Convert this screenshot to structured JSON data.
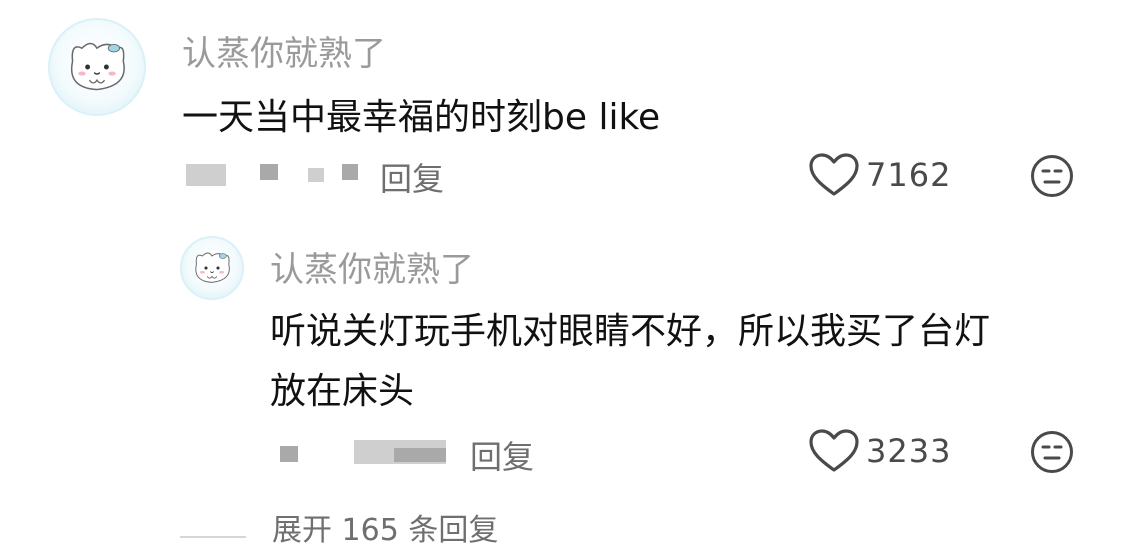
{
  "comment": {
    "username": "认蒸你就熟了",
    "text": "一天当中最幸福的时刻be like",
    "reply_label": "回复",
    "likes": "7162",
    "avatar_icon": "cat-avatar-icon",
    "like_icon": "heart-outline-icon",
    "dislike_icon": "meh-face-icon"
  },
  "reply": {
    "username": "认蒸你就熟了",
    "text_line1": "听说关灯玩手机对眼睛不好，所以我买了台灯",
    "text_line2": "放在床头",
    "reply_label": "回复",
    "likes": "3233",
    "avatar_icon": "cat-avatar-icon",
    "like_icon": "heart-outline-icon",
    "dislike_icon": "meh-face-icon"
  },
  "expand": {
    "label": "展开 165 条回复"
  },
  "colors": {
    "username": "#9a9a9a",
    "text": "#111111",
    "meta": "#6f6f6f",
    "icon": "#4a4a4a"
  }
}
